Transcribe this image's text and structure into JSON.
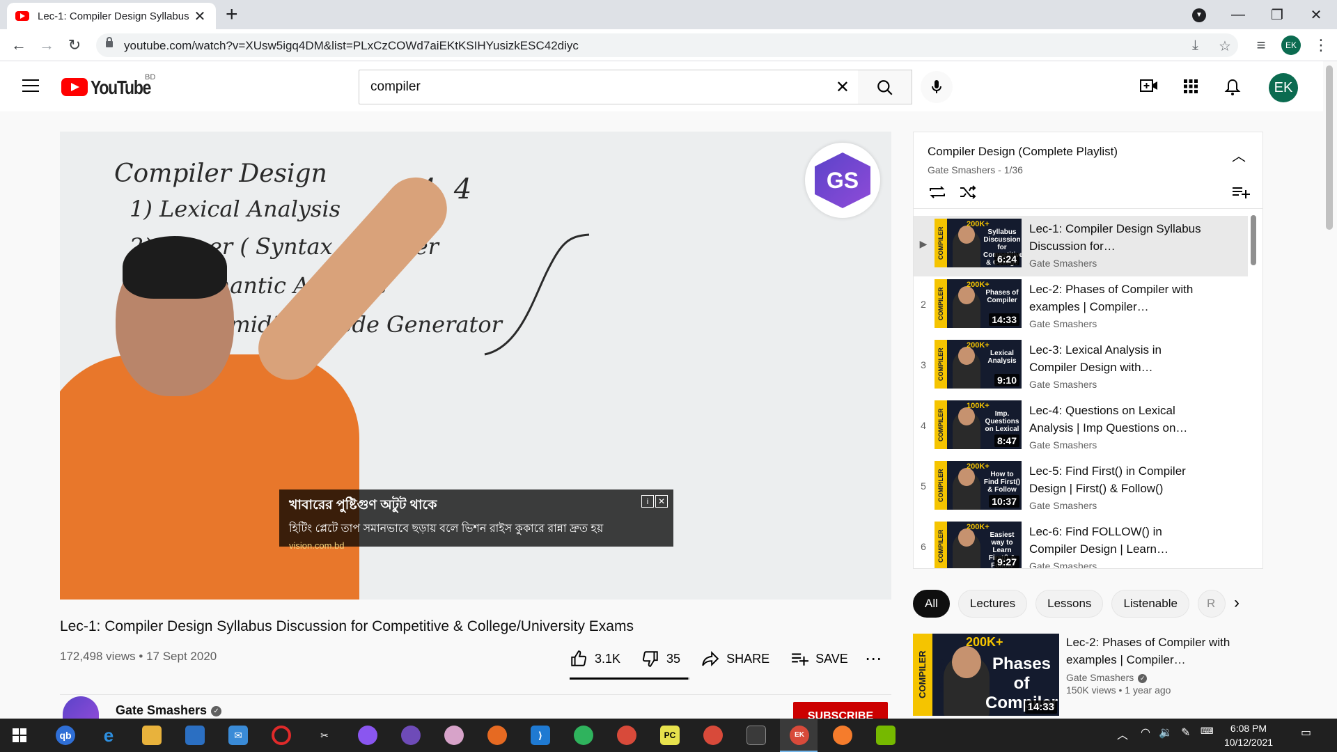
{
  "browser": {
    "tab_title": "Lec-1: Compiler Design Syllabus",
    "url": "youtube.com/watch?v=XUsw5igq4DM&list=PLxCzCOWd7aiEKtKSIHYusizkESC42diyc",
    "profile_initials": "EK"
  },
  "masthead": {
    "wordmark": "YouTube",
    "country": "BD",
    "search_value": "compiler",
    "avatar_initials": "EK"
  },
  "player": {
    "board_lines": [
      "Compiler Design",
      "1) Lexical Analysis",
      "2) Parser ( Syntax Analyzer",
      "3) Semantic Analysis",
      "4) Intermidiate Code Generator",
      "4, 4"
    ],
    "logo_text": "GS",
    "ad": {
      "title": "খাবারের পুষ্টিগুণ অটুট থাকে",
      "description": "হিটিং প্লেটে তাপ সমানভাবে ছড়ায় বলে ভিশন রাইস কুকারে রান্না দ্রুত হয়",
      "url": "vision.com.bd"
    }
  },
  "video": {
    "title": "Lec-1: Compiler Design Syllabus Discussion for Competitive & College/University Exams",
    "meta": "172,498 views • 17 Sept 2020",
    "likes": "3.1K",
    "dislikes": "35",
    "share_label": "SHARE",
    "save_label": "SAVE",
    "like_ratio": 0.989
  },
  "channel": {
    "name": "Gate Smashers",
    "subscribe_label": "SUBSCRIBE"
  },
  "playlist": {
    "title": "Compiler Design (Complete Playlist)",
    "subtitle": "Gate Smashers - 1/36",
    "items": [
      {
        "index": "▶",
        "title": "Lec-1: Compiler Design Syllabus Discussion for…",
        "channel": "Gate Smashers",
        "duration": "6:24",
        "badge": "200K+",
        "thumb_text": "Syllabus Discussion for Competitive & College"
      },
      {
        "index": "2",
        "title": "Lec-2: Phases of Compiler with examples | Compiler…",
        "channel": "Gate Smashers",
        "duration": "14:33",
        "badge": "200K+",
        "thumb_text": "Phases of Compiler"
      },
      {
        "index": "3",
        "title": "Lec-3: Lexical Analysis in Compiler Design with…",
        "channel": "Gate Smashers",
        "duration": "9:10",
        "badge": "200K+",
        "thumb_text": "Lexical Analysis"
      },
      {
        "index": "4",
        "title": "Lec-4: Questions on Lexical Analysis | Imp Questions on…",
        "channel": "Gate Smashers",
        "duration": "8:47",
        "badge": "100K+",
        "thumb_text": "Imp. Questions on Lexical"
      },
      {
        "index": "5",
        "title": "Lec-5: Find First() in Compiler Design | First() & Follow()",
        "channel": "Gate Smashers",
        "duration": "10:37",
        "badge": "200K+",
        "thumb_text": "How to Find First() & Follow"
      },
      {
        "index": "6",
        "title": "Lec-6: Find FOLLOW() in Compiler Design | Learn…",
        "channel": "Gate Smashers",
        "duration": "9:27",
        "badge": "200K+",
        "thumb_text": "Easiest way to Learn First() & Follow"
      }
    ]
  },
  "chips": [
    "All",
    "Lectures",
    "Lessons",
    "Listenable",
    "R"
  ],
  "recommendation": {
    "title": "Lec-2: Phases of Compiler with examples | Compiler…",
    "channel": "Gate Smashers",
    "meta": "150K views • 1 year ago",
    "duration": "14:33",
    "badge": "200K+",
    "thumb_text": "Phases of Compiler",
    "band_text": "COMPILER DESIGN"
  },
  "taskbar": {
    "time": "6:08 PM",
    "date": "10/12/2021"
  },
  "colors": {
    "youtube_red": "#ff0000",
    "subscribe_red": "#cc0000",
    "avatar_green": "#0b6b50",
    "thumb_yellow": "#f5c400"
  }
}
